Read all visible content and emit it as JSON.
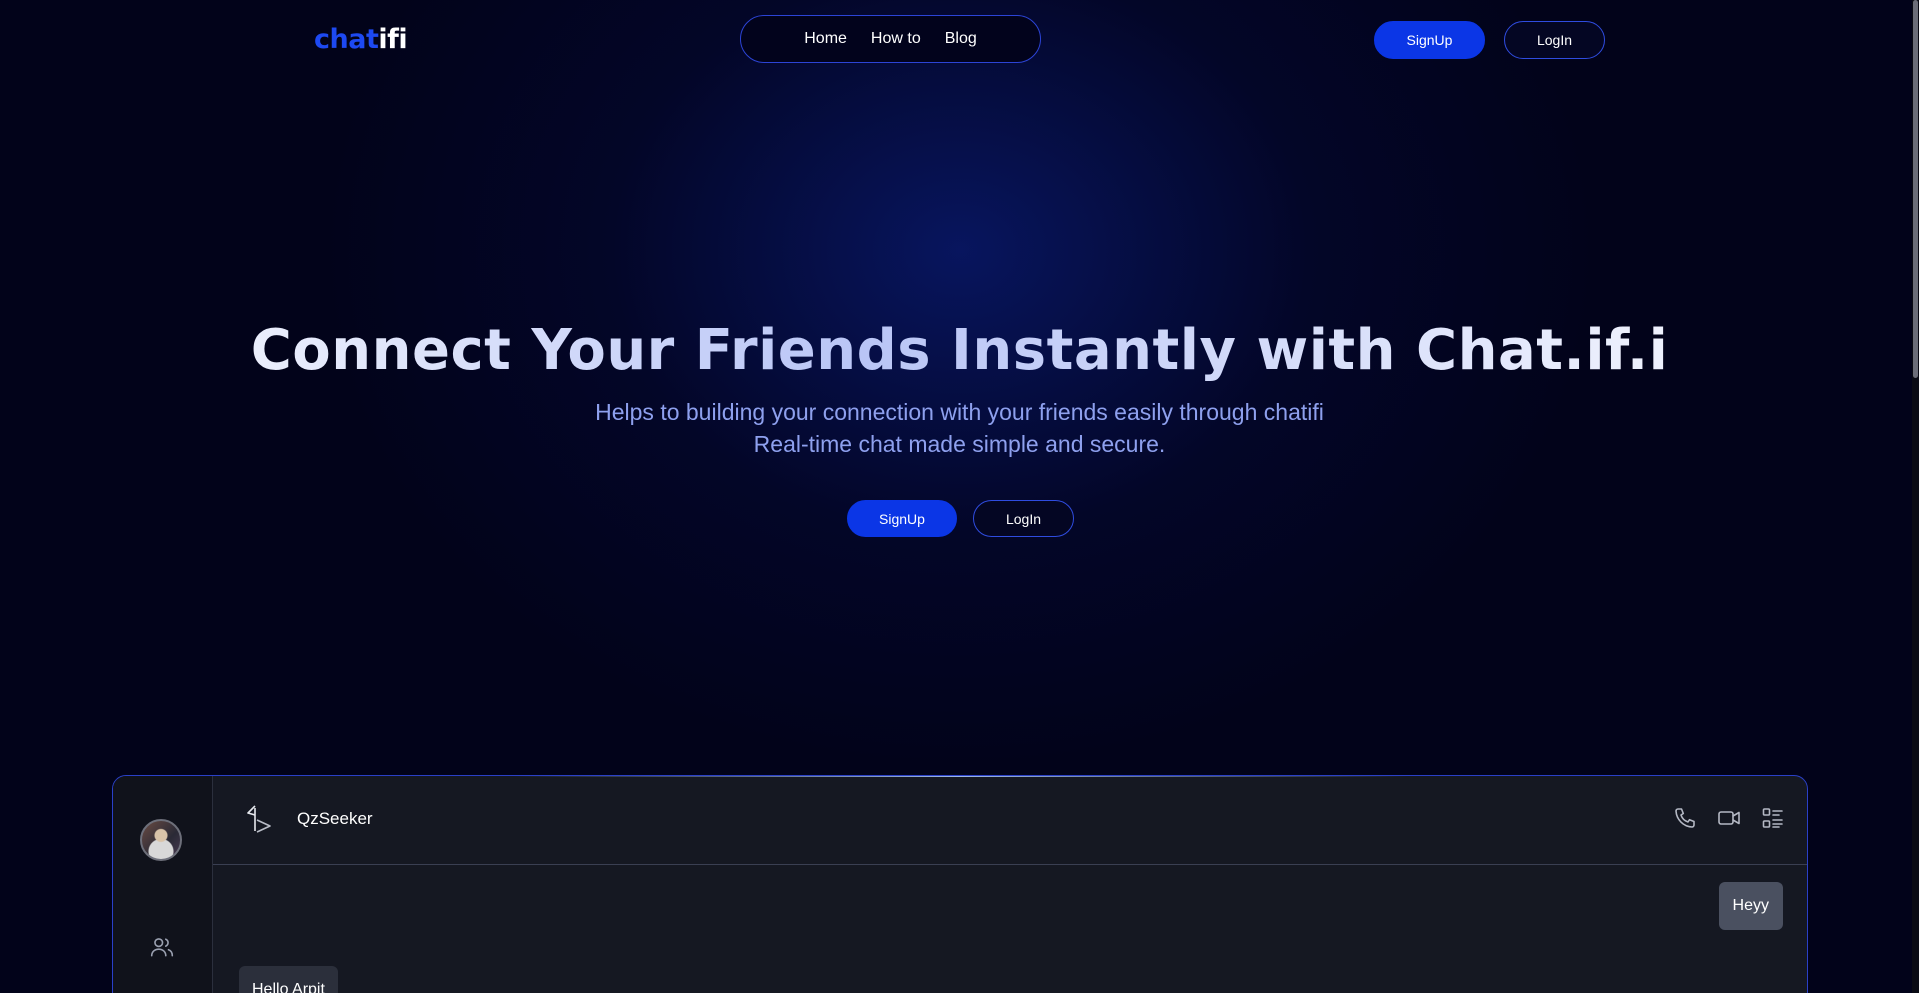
{
  "navbar": {
    "logo_part1": "chat",
    "logo_part2": "ifi",
    "links": [
      "Home",
      "How to",
      "Blog"
    ],
    "signup_label": "SignUp",
    "login_label": "LogIn"
  },
  "hero": {
    "title": "Connect Your Friends Instantly with Chat.if.i",
    "subtitle_line1": "Helps to building your connection with your friends easily through chatifi",
    "subtitle_line2": "Real-time chat made simple and secure.",
    "signup_label": "SignUp",
    "login_label": "LogIn"
  },
  "chat_preview": {
    "contact_name": "QzSeeker",
    "icons": [
      "profile-avatar",
      "users-icon",
      "contact-logo-icon",
      "phone-icon",
      "video-icon",
      "details-list-icon"
    ],
    "messages": [
      {
        "direction": "outgoing",
        "text": "Heyy"
      },
      {
        "direction": "incoming",
        "text": "Hello Arpit"
      }
    ]
  },
  "colors": {
    "background": "#02031a",
    "accent": "#0b36e6",
    "outline": "#2f4ce0",
    "logo_blue": "#1d49f2",
    "subtitle": "#8ea0ee",
    "chat_panel": "#151822"
  }
}
